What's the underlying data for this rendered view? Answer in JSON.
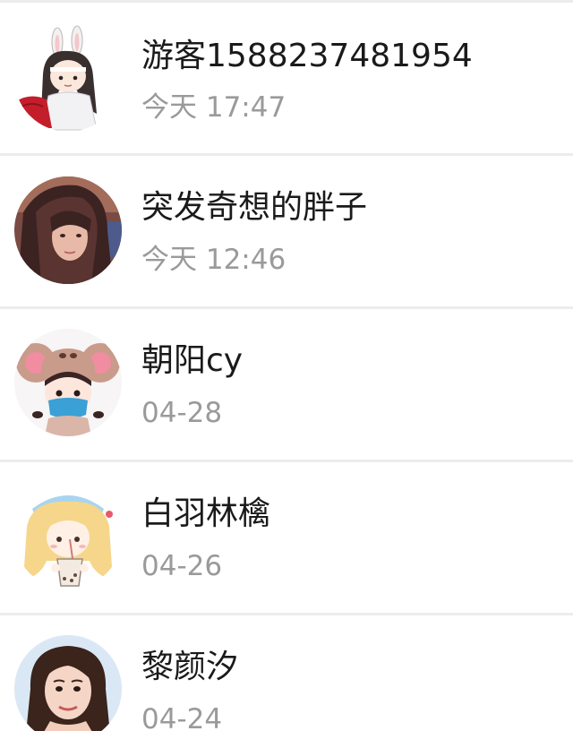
{
  "visitors": [
    {
      "name": "游客1588237481954",
      "time": "今天 17:47",
      "avatar_icon": "chibi-bunny-avatar-icon"
    },
    {
      "name": "突发奇想的胖子",
      "time": "今天 12:46",
      "avatar_icon": "selfie-photo-avatar-icon"
    },
    {
      "name": "朝阳cy",
      "time": "04-28",
      "avatar_icon": "mouse-hat-girl-avatar-icon"
    },
    {
      "name": "白羽林檎",
      "time": "04-26",
      "avatar_icon": "boba-girl-avatar-icon"
    },
    {
      "name": "黎颜汐",
      "time": "04-24",
      "avatar_icon": "portrait-photo-avatar-icon"
    }
  ],
  "colors": {
    "name_text": "#1a1a1a",
    "time_text": "#9a9a9a",
    "divider": "#ececec",
    "background": "#ffffff"
  }
}
